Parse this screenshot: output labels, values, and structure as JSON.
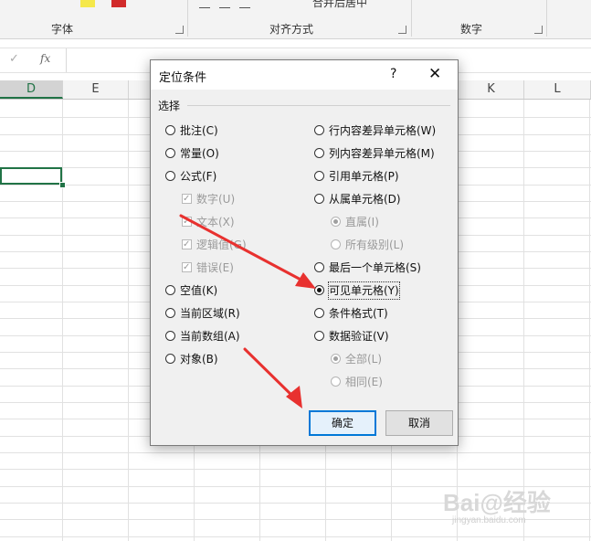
{
  "ribbon": {
    "groups": [
      {
        "label": "字体"
      },
      {
        "label": "对齐方式"
      },
      {
        "label": "数字"
      }
    ],
    "merge_label": "合并后居中"
  },
  "formula_bar": {
    "fx_label": "fx",
    "check_icon": "check-icon"
  },
  "columns": [
    "D",
    "E",
    "K",
    "L"
  ],
  "dialog": {
    "title": "定位条件",
    "help": "?",
    "close": "✕",
    "group_label": "选择",
    "left_options": [
      {
        "label": "批注(C)",
        "checked": false
      },
      {
        "label": "常量(O)",
        "checked": false
      },
      {
        "label": "公式(F)",
        "checked": false
      },
      {
        "label": "数字(U)",
        "checked": true,
        "disabled": true
      },
      {
        "label": "文本(X)",
        "checked": true,
        "disabled": true
      },
      {
        "label": "逻辑值(G)",
        "checked": true,
        "disabled": true
      },
      {
        "label": "错误(E)",
        "checked": true,
        "disabled": true
      },
      {
        "label": "空值(K)",
        "checked": false
      },
      {
        "label": "当前区域(R)",
        "checked": false
      },
      {
        "label": "当前数组(A)",
        "checked": false
      },
      {
        "label": "对象(B)",
        "checked": false
      }
    ],
    "right_options": [
      {
        "label": "行内容差异单元格(W)",
        "checked": false
      },
      {
        "label": "列内容差异单元格(M)",
        "checked": false
      },
      {
        "label": "引用单元格(P)",
        "checked": false
      },
      {
        "label": "从属单元格(D)",
        "checked": false
      },
      {
        "label": "直属(I)",
        "checked": true,
        "disabled": true
      },
      {
        "label": "所有级别(L)",
        "checked": false,
        "disabled": true
      },
      {
        "label": "最后一个单元格(S)",
        "checked": false
      },
      {
        "label": "可见单元格(Y)",
        "checked": true
      },
      {
        "label": "条件格式(T)",
        "checked": false
      },
      {
        "label": "数据验证(V)",
        "checked": false
      },
      {
        "label": "全部(L)",
        "checked": true,
        "disabled": true
      },
      {
        "label": "相同(E)",
        "checked": false,
        "disabled": true
      }
    ],
    "ok": "确定",
    "cancel": "取消"
  },
  "watermark": {
    "main": "Bai@经验",
    "sub": "jingyan.baidu.com"
  },
  "colors": {
    "excel_green": "#217346",
    "arrow_red": "#e8312f",
    "focus_blue": "#0078d7"
  }
}
